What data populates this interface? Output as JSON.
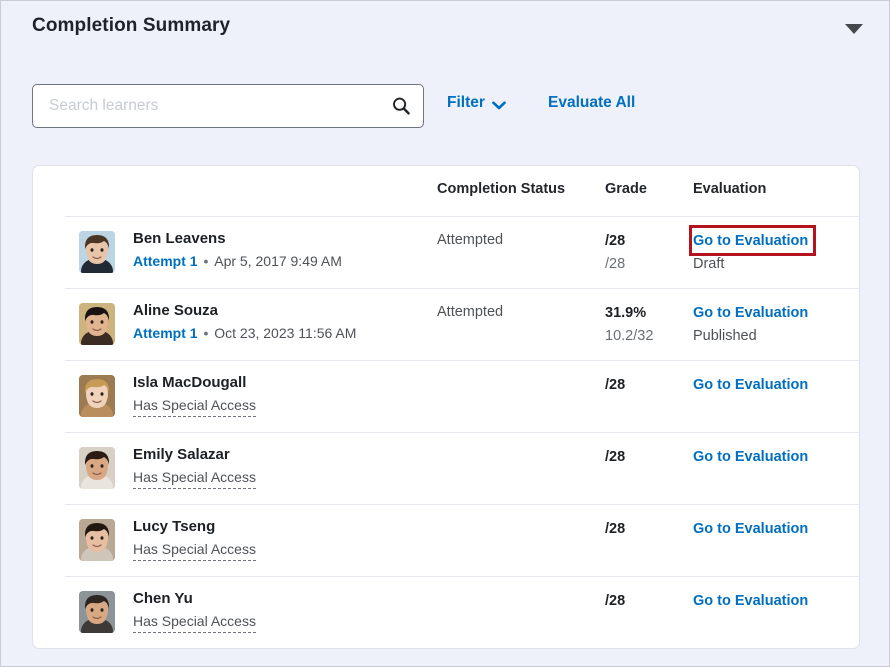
{
  "panel": {
    "title": "Completion Summary",
    "collapse_icon": "triangle-down-icon"
  },
  "toolbar": {
    "search_placeholder": "Search learners",
    "search_value": "",
    "search_icon": "search-icon",
    "filter_label": "Filter",
    "filter_icon": "chevron-down-icon",
    "evaluate_all_label": "Evaluate All"
  },
  "table": {
    "columns": {
      "learner": "",
      "status": "Completion Status",
      "grade": "Grade",
      "evaluation": "Evaluation"
    },
    "rows": [
      {
        "name": "Ben Leavens",
        "sub_type": "attempt",
        "attempt_label": "Attempt 1",
        "separator": "•",
        "timestamp": "Apr 5, 2017 9:49 AM",
        "status": "Attempted",
        "grade_main": "/28",
        "grade_sub": "/28",
        "eval_link": "Go to Evaluation",
        "eval_state": "Draft",
        "highlighted": true
      },
      {
        "name": "Aline Souza",
        "sub_type": "attempt",
        "attempt_label": "Attempt 1",
        "separator": "•",
        "timestamp": "Oct 23, 2023 11:56 AM",
        "status": "Attempted",
        "grade_main": "31.9%",
        "grade_sub": "10.2/32",
        "eval_link": "Go to Evaluation",
        "eval_state": "Published",
        "highlighted": false
      },
      {
        "name": "Isla MacDougall",
        "sub_type": "special",
        "special_label": "Has Special Access",
        "status": "",
        "grade_main": "/28",
        "grade_sub": "",
        "eval_link": "Go to Evaluation",
        "eval_state": "",
        "highlighted": false
      },
      {
        "name": "Emily Salazar",
        "sub_type": "special",
        "special_label": "Has Special Access",
        "status": "",
        "grade_main": "/28",
        "grade_sub": "",
        "eval_link": "Go to Evaluation",
        "eval_state": "",
        "highlighted": false
      },
      {
        "name": "Lucy Tseng",
        "sub_type": "special",
        "special_label": "Has Special Access",
        "status": "",
        "grade_main": "/28",
        "grade_sub": "",
        "eval_link": "Go to Evaluation",
        "eval_state": "",
        "highlighted": false
      },
      {
        "name": "Chen Yu",
        "sub_type": "special",
        "special_label": "Has Special Access",
        "status": "",
        "grade_main": "/28",
        "grade_sub": "",
        "eval_link": "Go to Evaluation",
        "eval_state": "",
        "highlighted": false
      }
    ]
  },
  "colors": {
    "link": "#006fbf",
    "panel_background": "#eef1fa",
    "card_background": "#ffffff",
    "highlight_outline": "#b3141e",
    "text_primary": "#1d2025",
    "text_secondary": "#4e5257"
  },
  "avatars": [
    {
      "name": "ben-leavens-avatar",
      "bg": "#bcd5e4",
      "skin": "#e8c4a8",
      "hair": "#4a3424",
      "shirt": "#222a36"
    },
    {
      "name": "aline-souza-avatar",
      "bg": "#cdb47f",
      "skin": "#e0b391",
      "hair": "#1a1210",
      "shirt": "#3a2b24"
    },
    {
      "name": "isla-macdougall-avatar",
      "bg": "#9c7a52",
      "skin": "#f0d2bb",
      "hair": "#c79a55",
      "shirt": "#b98d5c"
    },
    {
      "name": "emily-salazar-avatar",
      "bg": "#d8d0c4",
      "skin": "#d8a783",
      "hair": "#2a1c14",
      "shirt": "#e9e4dc"
    },
    {
      "name": "lucy-tseng-avatar",
      "bg": "#b8a894",
      "skin": "#e6bfa2",
      "hair": "#23170f",
      "shirt": "#cfc6ba"
    },
    {
      "name": "chen-yu-avatar",
      "bg": "#8d9498",
      "skin": "#d8a882",
      "hair": "#2e2620",
      "shirt": "#3d3a37"
    }
  ]
}
